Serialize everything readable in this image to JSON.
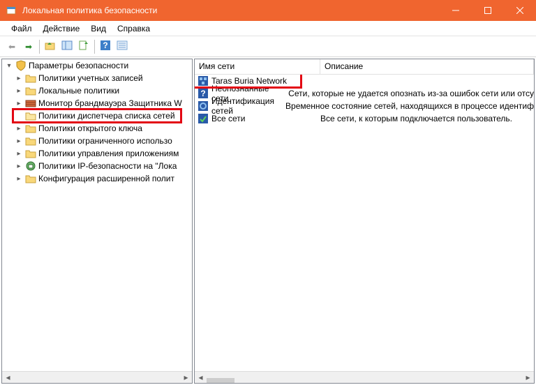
{
  "window": {
    "title": "Локальная политика безопасности"
  },
  "menu": {
    "file": "Файл",
    "action": "Действие",
    "view": "Вид",
    "help": "Справка"
  },
  "tree": {
    "root": "Параметры безопасности",
    "items": [
      "Политики учетных записей",
      "Локальные политики",
      "Монитор брандмауэра Защитника W",
      "Политики диспетчера списка сетей",
      "Политики открытого ключа",
      "Политики ограниченного использо",
      "Политики управления приложениям",
      "Политики IP-безопасности на \"Лока",
      "Конфигурация расширенной полит"
    ]
  },
  "list": {
    "col_name": "Имя сети",
    "col_desc": "Описание",
    "rows": [
      {
        "name": "Taras Buria Network",
        "desc": ""
      },
      {
        "name": "Неопознанные сети",
        "desc": "Сети, которые не удается опознать из-за ошибок сети или отсу"
      },
      {
        "name": "Идентификация сетей",
        "desc": "Временное состояние сетей, находящихся в процессе идентиф"
      },
      {
        "name": "Все сети",
        "desc": "Все сети, к которым подключается пользователь."
      }
    ]
  }
}
